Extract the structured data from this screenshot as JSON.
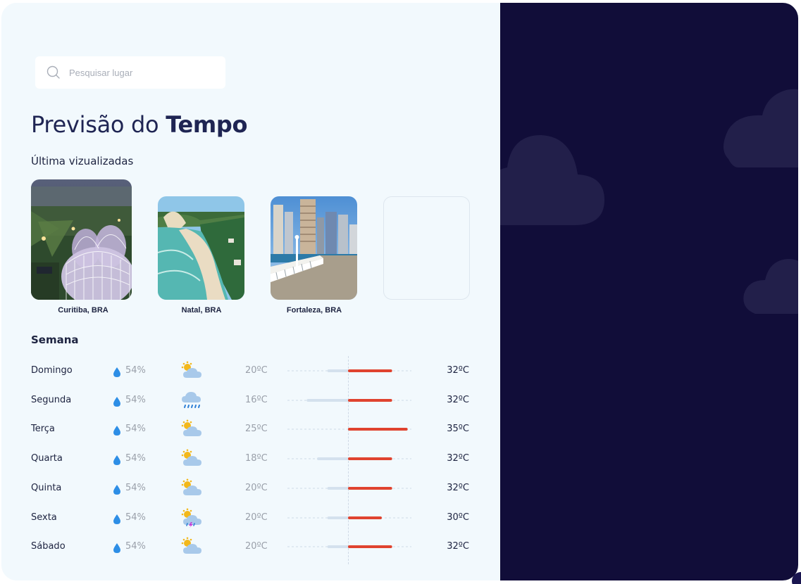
{
  "search": {
    "placeholder": "Pesquisar lugar"
  },
  "title": {
    "prefix": "Previsão do ",
    "bold": "Tempo"
  },
  "recent": {
    "heading": "Última vizualizadas",
    "cities": [
      {
        "label": "Curitiba, BRA"
      },
      {
        "label": "Natal, BRA"
      },
      {
        "label": "Fortaleza, BRA"
      }
    ]
  },
  "week": {
    "heading": "Semana",
    "days": [
      {
        "day": "Domingo",
        "humidity": "54%",
        "icon": "sun-cloud-icon",
        "min": "20ºC",
        "max": "32ºC",
        "min_value": 20,
        "max_value": 32
      },
      {
        "day": "Segunda",
        "humidity": "54%",
        "icon": "rain-cloud-icon",
        "min": "16ºC",
        "max": "32ºC",
        "min_value": 16,
        "max_value": 32
      },
      {
        "day": "Terça",
        "humidity": "54%",
        "icon": "sun-cloud-icon",
        "min": "25ºC",
        "max": "35ºC",
        "min_value": 25,
        "max_value": 35
      },
      {
        "day": "Quarta",
        "humidity": "54%",
        "icon": "sun-cloud-icon",
        "min": "18ºC",
        "max": "32ºC",
        "min_value": 18,
        "max_value": 32
      },
      {
        "day": "Quinta",
        "humidity": "54%",
        "icon": "sun-cloud-icon",
        "min": "20ºC",
        "max": "32ºC",
        "min_value": 20,
        "max_value": 32
      },
      {
        "day": "Sexta",
        "humidity": "54%",
        "icon": "storm-sun-icon",
        "min": "20ºC",
        "max": "30ºC",
        "min_value": 20,
        "max_value": 30
      },
      {
        "day": "Sábado",
        "humidity": "54%",
        "icon": "sun-cloud-icon",
        "min": "20ºC",
        "max": "32ºC",
        "min_value": 20,
        "max_value": 32
      }
    ]
  },
  "colors": {
    "accent_red": "#e0432f",
    "dark_panel": "#110d39",
    "light_bg": "#f2f9fd",
    "drop_blue": "#2d8ee6"
  }
}
